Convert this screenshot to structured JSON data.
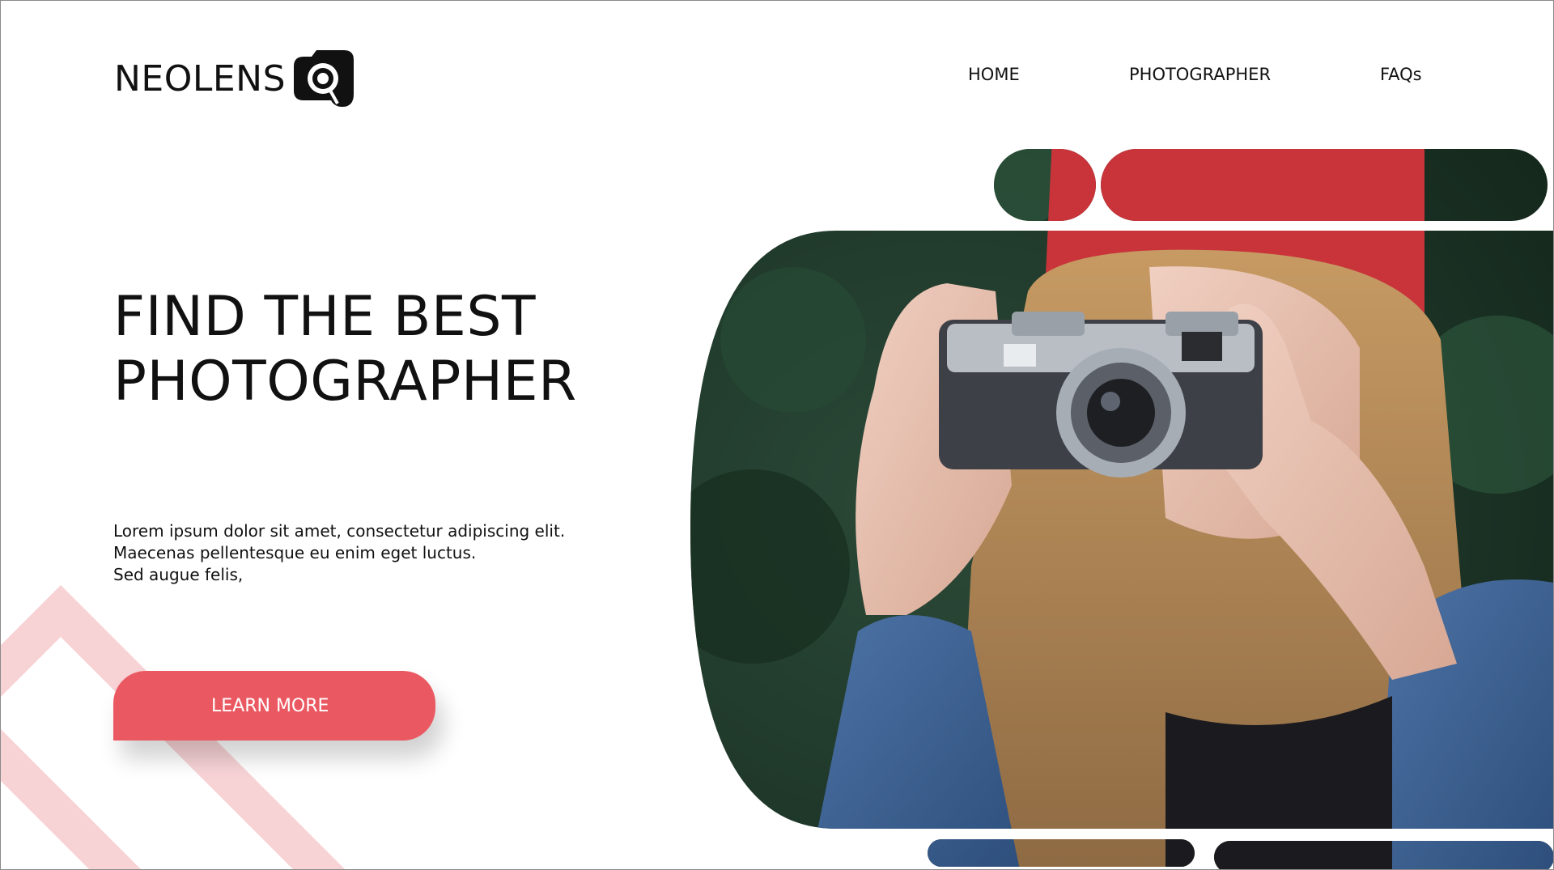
{
  "brand": {
    "name": "NEOLENS",
    "logo_icon": "camera-lens-icon"
  },
  "nav": {
    "items": [
      {
        "label": "HOME"
      },
      {
        "label": "PHOTOGRAPHER"
      },
      {
        "label": "FAQs"
      }
    ]
  },
  "hero": {
    "title_line1": "FIND THE BEST",
    "title_line2": "PHOTOGRAPHER",
    "description_line1": "Lorem ipsum dolor sit amet, consectetur adipiscing elit.",
    "description_line2": "Maecenas pellentesque eu enim eget luctus.",
    "description_line3": "Sed augue felis,",
    "cta_label": "LEARN MORE"
  },
  "colors": {
    "accent": "#ea5961",
    "decor_pink": "#f7d3d6",
    "text": "#111111",
    "photo_foliage": "#1f3a2c",
    "photo_hat": "#c8343a",
    "photo_hair": "#b48a5a",
    "photo_denim": "#3b5f8f"
  }
}
